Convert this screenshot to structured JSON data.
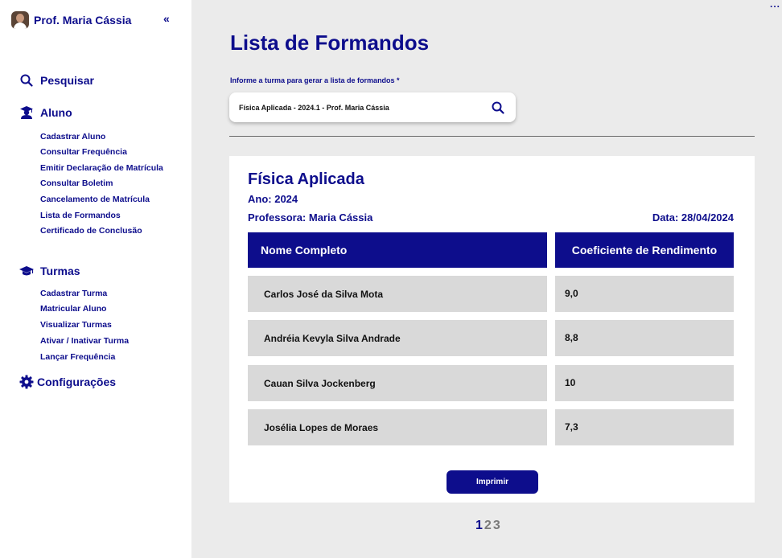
{
  "sidebar": {
    "profile_name": "Prof. Maria Cássia",
    "collapse_label": "«",
    "search_label": "Pesquisar",
    "aluno": {
      "label": "Aluno",
      "items": [
        "Cadastrar Aluno",
        "Consultar Frequência",
        "Emitir Declaração de Matrícula",
        "Consultar Boletim",
        "Cancelamento de Matrícula",
        "Lista de Formandos",
        "Certificado de Conclusão"
      ]
    },
    "turmas": {
      "label": "Turmas",
      "items": [
        "Cadastrar Turma",
        "Matricular Aluno",
        "Visualizar Turmas",
        "Ativar / Inativar Turma",
        "Lançar Frequência"
      ]
    },
    "settings_label": "Configurações"
  },
  "menu_dots": "...",
  "main": {
    "title": "Lista de Formandos",
    "field_label": "Informe a turma para gerar a lista de formandos *",
    "search_value": "Física Aplicada - 2024.1 - Prof. Maria Cássia"
  },
  "report": {
    "course": "Física Aplicada",
    "year": "Ano: 2024",
    "teacher": "Professora: Maria Cássia",
    "date": "Data: 28/04/2024",
    "headers": {
      "name": "Nome Completo",
      "coef": "Coeficiente de Rendimento"
    },
    "rows": [
      {
        "name": "Carlos José da Silva Mota",
        "coef": "9,0"
      },
      {
        "name": "Andréia  Kevyla Silva Andrade",
        "coef": "8,8"
      },
      {
        "name": "Cauan Silva Jockenberg",
        "coef": "10"
      },
      {
        "name": "Josélia Lopes de Moraes",
        "coef": "7,3"
      }
    ],
    "print_label": "Imprimir"
  },
  "pagination": {
    "pages": [
      "1",
      "2",
      "3"
    ],
    "current": "1"
  },
  "colors": {
    "primary": "#0d0d8c",
    "background": "#ebebeb",
    "row_bg": "#d9d9d9"
  }
}
